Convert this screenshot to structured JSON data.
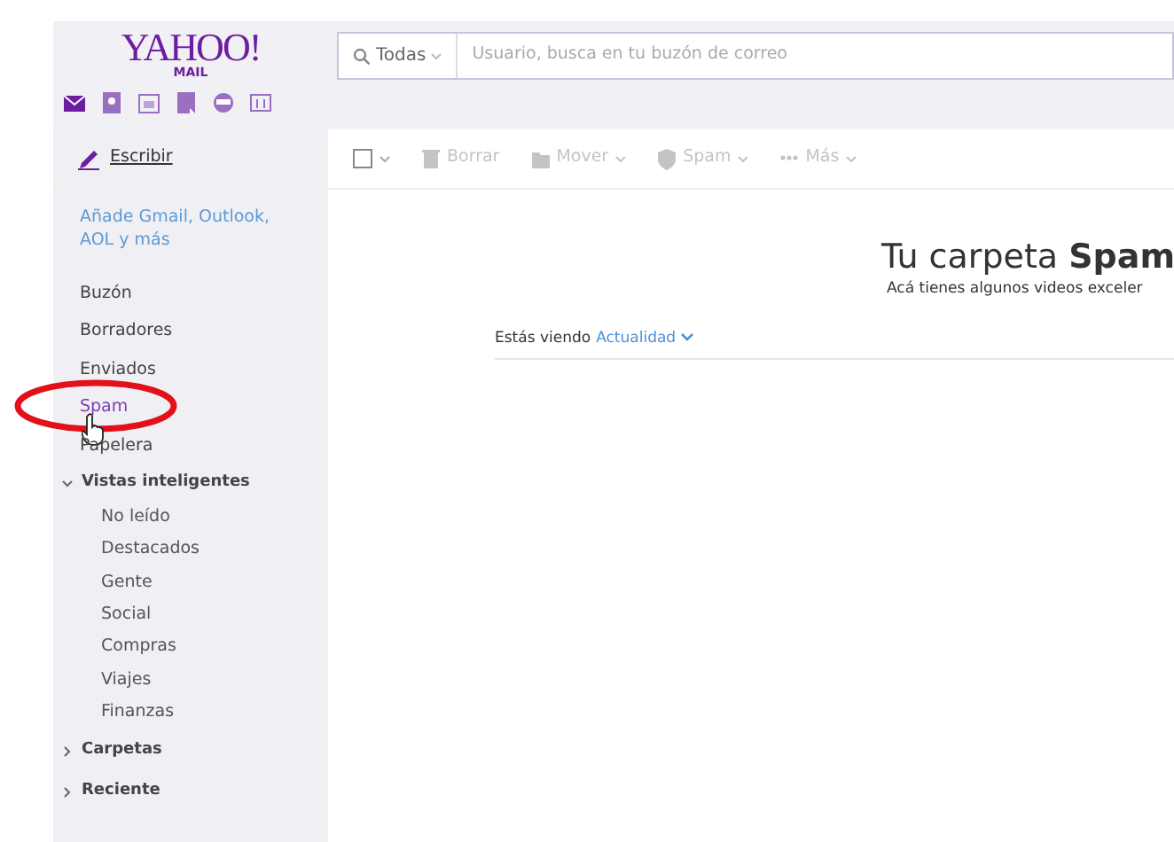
{
  "logo": {
    "name": "YAHOO!",
    "sub": "MAIL"
  },
  "app_icons": [
    {
      "kind": "mail",
      "selected": true
    },
    {
      "kind": "contacts",
      "selected": false
    },
    {
      "kind": "calendar",
      "selected": false
    },
    {
      "kind": "notepad",
      "selected": false
    },
    {
      "kind": "messenger",
      "selected": false
    },
    {
      "kind": "news",
      "selected": false
    }
  ],
  "search": {
    "scope": "Todas",
    "placeholder": "Usuario, busca en tu buzón de correo"
  },
  "compose": "Escribir",
  "toolbar": [
    {
      "kind": "checkbox",
      "disabled": true
    },
    {
      "kind": "delete",
      "label": "Borrar",
      "disabled": true
    },
    {
      "kind": "move",
      "label": "Mover",
      "disabled": true
    },
    {
      "kind": "spam",
      "label": "Spam",
      "disabled": true
    },
    {
      "kind": "more",
      "label": "Más",
      "disabled": true
    }
  ],
  "add_accounts": "Añade Gmail, Outlook, AOL y más",
  "folders": [
    {
      "label": "Buzón",
      "selected": false,
      "circled": false
    },
    {
      "label": "Borradores",
      "selected": false,
      "circled": false
    },
    {
      "label": "Enviados",
      "selected": false,
      "circled": false
    },
    {
      "label": "Spam",
      "selected": true,
      "circled": true
    },
    {
      "label": "Papelera",
      "selected": false,
      "circled": false
    }
  ],
  "sections": [
    {
      "label": "Vistas inteligentes",
      "expanded": true,
      "children": [
        {
          "label": "No leído"
        },
        {
          "label": "Destacados"
        },
        {
          "label": "Gente"
        },
        {
          "label": "Social"
        },
        {
          "label": "Compras"
        },
        {
          "label": "Viajes"
        },
        {
          "label": "Finanzas"
        }
      ]
    },
    {
      "label": "Carpetas",
      "expanded": false
    },
    {
      "label": "Reciente",
      "expanded": false
    }
  ],
  "main": {
    "title": "Tu carpeta **Spam**",
    "subtitle": "Acá tienes algunos videos exceler",
    "viewing": "Estás viendo",
    "filter": "Actualidad"
  }
}
